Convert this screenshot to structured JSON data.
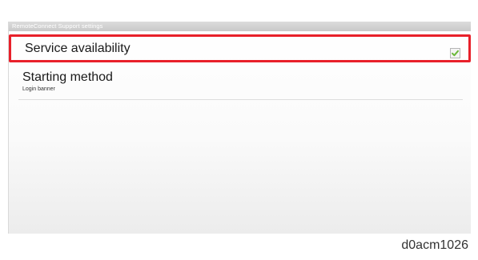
{
  "section_header": "RemoteConnect Support settings",
  "settings": [
    {
      "title": "Service availability",
      "checked": true
    },
    {
      "title": "Starting method",
      "subtitle": "Login banner"
    }
  ],
  "colors": {
    "highlight": "#e8202a",
    "check": "#6bb83a"
  },
  "icons": {
    "checkbox": "checkmark-icon"
  },
  "caption": "d0acm1026"
}
